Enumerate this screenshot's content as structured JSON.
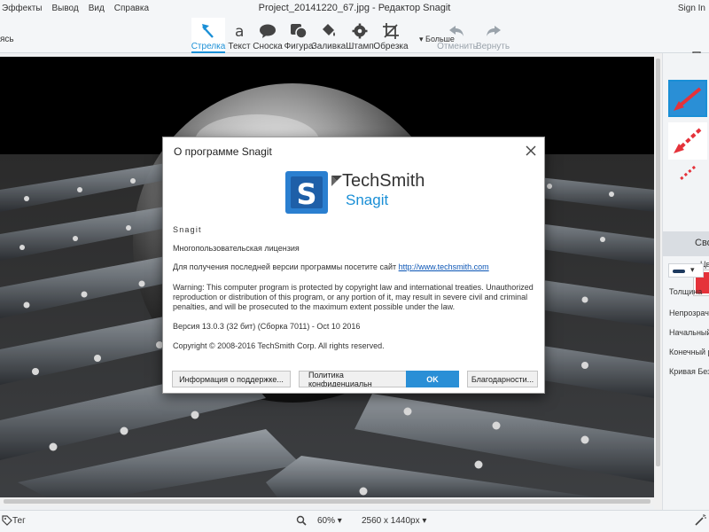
{
  "titlebar": {
    "menu": [
      "Эффекты",
      "Вывод",
      "Вид",
      "Справка"
    ],
    "doc_title": "Project_20141220_67.jpg - Редактор Snagit",
    "sign_in": "Sign In"
  },
  "toolbar": {
    "left_label": "ясь",
    "tools": [
      {
        "label": "Стрелка",
        "icon": "arrow-pointer-icon"
      },
      {
        "label": "Текст",
        "icon": "text-a-icon"
      },
      {
        "label": "Сноска",
        "icon": "speech-bubble-icon"
      },
      {
        "label": "Фигура",
        "icon": "shape-icon"
      },
      {
        "label": "Заливка",
        "icon": "fill-bucket-icon"
      },
      {
        "label": "Штамп",
        "icon": "stamp-gear-icon"
      },
      {
        "label": "Обрезка",
        "icon": "crop-icon"
      }
    ],
    "more_label": "Больше",
    "undo_label": "Отменить",
    "redo_label": "Вернуть"
  },
  "right_panel": {
    "props_tab": "Сво",
    "color_label": "Цв",
    "rows": [
      "Толщина",
      "Непрозрач",
      "Начальный",
      "Конечный р",
      "Кривая Без"
    ],
    "accent_color": "#e5323a"
  },
  "statusbar": {
    "tag_label": "Тег",
    "zoom": "60%",
    "dimensions": "2560 x 1440px"
  },
  "dialog": {
    "title": "О программе Snagit",
    "brand_company": "TechSmith",
    "brand_product": "Snagit",
    "product_name": "Snagit",
    "license": "Многопользовательская лицензия",
    "update_text": "Для получения последней версии программы посетите сайт",
    "link": "http://www.techsmith.com",
    "warning_lines": [
      "Warning: This computer program is protected by copyright law and international treaties. Unauthorized",
      "reproduction or distribution of this program, or any portion of it, may result in severe civil and criminal",
      "penalties, and will be prosecuted to the maximum extent possible under the law."
    ],
    "version": "Версия 13.0.3 (32 бит) (Сборка 7011) - Oct 10 2016",
    "copyright": "Copyright © 2008-2016 TechSmith Corp. All rights reserved.",
    "buttons": {
      "support": "Информация о поддержке...",
      "privacy": "Политика конфиденциальн",
      "ok": "OK",
      "thanks": "Благодарности..."
    }
  }
}
